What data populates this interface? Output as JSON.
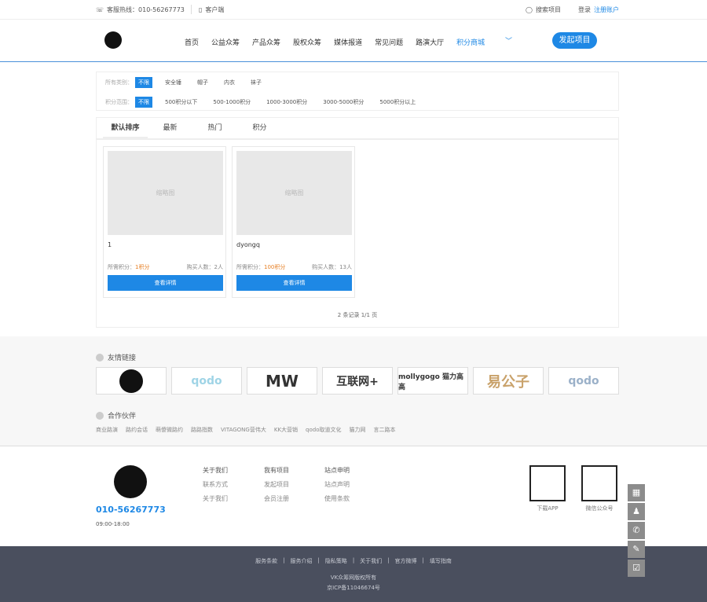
{
  "topbar": {
    "hotline": "客服热线：010-56267773",
    "client": "客户端",
    "search": "搜索项目",
    "login": "登录",
    "register": "注册账户"
  },
  "nav": {
    "items": [
      "首页",
      "公益众筹",
      "产品众筹",
      "股权众筹",
      "媒体报道",
      "常见问题",
      "路演大厅",
      "积分商城"
    ],
    "dropdown": "﹀",
    "launch": "发起项目"
  },
  "filter": {
    "category_label": "所有类别：",
    "categories": [
      "不限",
      "安全锤",
      "帽子",
      "内衣",
      "袜子"
    ],
    "points_label": "积分范围：",
    "points": [
      "不限",
      "500积分以下",
      "500-1000积分",
      "1000-3000积分",
      "3000-5000积分",
      "5000积分以上"
    ]
  },
  "tabs": [
    "默认排序",
    "最新",
    "热门",
    "积分"
  ],
  "cards": [
    {
      "thumb": "缩略图",
      "title": "1",
      "points": "1积分",
      "points_prefix": "所需积分：",
      "buyers": "购买人数：2人",
      "button": "查看详情"
    },
    {
      "thumb": "缩略图",
      "title": "dyongq",
      "points": "100积分",
      "points_prefix": "所需积分：",
      "buyers": "购买人数：13人",
      "button": "查看详情"
    }
  ],
  "pager": "2 条记录 1/1 页",
  "friend_links": {
    "title": "友情链接",
    "logos": [
      "qodo",
      "MW",
      "互联网+",
      "mollygogo 猫力高高",
      "易公子",
      "qodo"
    ]
  },
  "partners": {
    "title": "合作伙伴",
    "items": [
      "商业路演",
      "路约会话",
      "萌傻微路约",
      "路路指数",
      "VITAGONG营伟大",
      "KK大营销",
      "qodo取道文化",
      "猫力网",
      "言二路本"
    ]
  },
  "footer": {
    "phone": "010-56267773",
    "hours": "09:00-18:00",
    "cols": [
      {
        "h": "关于我们",
        "items": [
          "联系方式",
          "关于我们"
        ]
      },
      {
        "h": "我有项目",
        "items": [
          "发起项目",
          "会员注册"
        ]
      },
      {
        "h": "站点申明",
        "items": [
          "站点声明",
          "使用条款"
        ]
      }
    ],
    "qr": [
      {
        "label": "下载APP"
      },
      {
        "label": "微信公众号"
      }
    ]
  },
  "bottom": {
    "links": [
      "服务条款",
      "服务介绍",
      "隐私策略",
      "关于我们",
      "官方微博",
      "填写指南"
    ],
    "copy": "VK众筹网版权所有",
    "icp": "京ICP备11046674号"
  },
  "side": [
    "▦",
    "♟",
    "✆",
    "✎",
    "☑"
  ]
}
